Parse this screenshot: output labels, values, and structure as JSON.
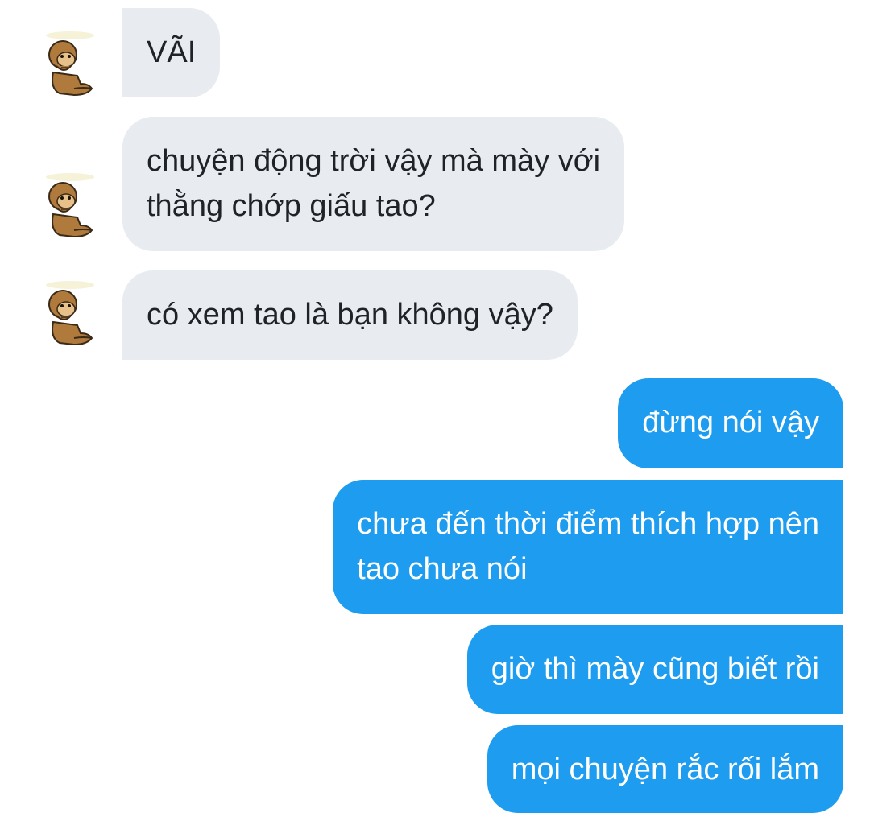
{
  "conversation": {
    "incoming": [
      {
        "text": "VÃI"
      },
      {
        "line1": "chuyện động trời vậy mà mày với",
        "line2": "thằng chớp giấu tao?"
      },
      {
        "text": "có xem tao là bạn không vậy?"
      }
    ],
    "outgoing": [
      {
        "text": "đừng nói vậy"
      },
      {
        "line1": "chưa đến thời điểm thích hợp nên",
        "line2": "tao chưa nói"
      },
      {
        "text": "giờ thì mày cũng biết rồi"
      },
      {
        "text": "mọi chuyện rắc rối lắm"
      }
    ]
  },
  "avatar": {
    "icon": "monkey-avatar-icon"
  },
  "colors": {
    "incoming_bubble": "#e8ebf0",
    "outgoing_bubble": "#1e9df0",
    "incoming_text": "#1f2328",
    "outgoing_text": "#ffffff"
  }
}
